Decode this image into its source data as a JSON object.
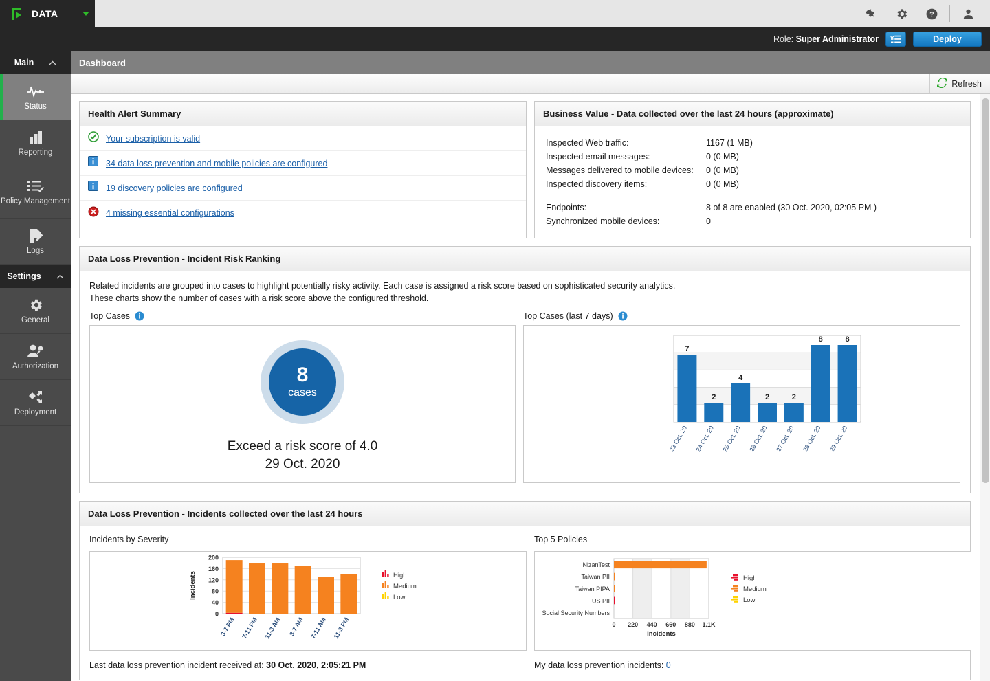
{
  "brand": {
    "name": "DATA",
    "logo_icon": "forcepoint-logo-icon",
    "caret_icon": "chevron-down-icon"
  },
  "topbar": {
    "icons": [
      {
        "name": "plugin-icon",
        "glyph": "plug"
      },
      {
        "name": "gear-icon",
        "glyph": "gear"
      },
      {
        "name": "help-icon",
        "glyph": "question"
      },
      {
        "name": "user-icon",
        "glyph": "user"
      }
    ]
  },
  "rolebar": {
    "role_prefix": "Role:",
    "role_value": "Super Administrator",
    "list_icon": "task-list-icon",
    "deploy_label": "Deploy",
    "accent": "#1377c0"
  },
  "sidebar": {
    "main_label": "Main",
    "main_caret_icon": "chevron-up-icon",
    "settings_label": "Settings",
    "settings_caret_icon": "chevron-up-icon",
    "items": [
      {
        "label": "Status",
        "icon": "pulse-icon",
        "active": true
      },
      {
        "label": "Reporting",
        "icon": "bar-chart-icon",
        "active": false
      },
      {
        "label": "Policy Management",
        "icon": "checklist-icon",
        "active": false
      },
      {
        "label": "Logs",
        "icon": "document-edit-icon",
        "active": false
      }
    ],
    "settings_items": [
      {
        "label": "General",
        "icon": "gear-icon"
      },
      {
        "label": "Authorization",
        "icon": "user-key-icon"
      },
      {
        "label": "Deployment",
        "icon": "deployment-icon"
      }
    ]
  },
  "page": {
    "title": "Dashboard"
  },
  "toolbar": {
    "refresh_label": "Refresh",
    "refresh_icon": "refresh-icon"
  },
  "health": {
    "title": "Health Alert Summary",
    "rows": [
      {
        "icon": "success-check-icon",
        "text": "Your subscription is valid"
      },
      {
        "icon": "info-icon",
        "text": "34 data loss prevention and mobile policies are configured"
      },
      {
        "icon": "info-icon",
        "text": "19 discovery policies are configured"
      },
      {
        "icon": "error-icon",
        "text": "4 missing essential configurations"
      }
    ]
  },
  "business": {
    "title": "Business Value - Data collected over the last 24 hours (approximate)",
    "rows": [
      {
        "key": "Inspected Web traffic:",
        "value": "1167 (1 MB)"
      },
      {
        "key": "Inspected email messages:",
        "value": "0 (0 MB)"
      },
      {
        "key": "Messages delivered to mobile devices:",
        "value": "0 (0 MB)"
      },
      {
        "key": "Inspected discovery items:",
        "value": "0 (0 MB)"
      }
    ],
    "rows2": [
      {
        "key": "Endpoints:",
        "value": "8 of 8 are enabled (30 Oct. 2020, 02:05 PM )"
      },
      {
        "key": "Synchronized mobile devices:",
        "value": "0"
      }
    ]
  },
  "risk": {
    "title": "Data Loss Prevention - Incident Risk Ranking",
    "desc_line1": "Related incidents are grouped into cases to highlight potentially risky activity. Each case is assigned a risk score based on sophisticated security analytics.",
    "desc_line2": "These charts show the number of cases with a risk score above the configured threshold.",
    "left_caption": "Top Cases",
    "right_caption": "Top Cases (last 7 days)",
    "info_icon": "info-circle-icon",
    "donut": {
      "count": "8",
      "unit": "cases",
      "caption_line1": "Exceed a risk score of 4.0",
      "caption_line2": "29 Oct. 2020",
      "ring_color": "#ccdcea",
      "fill_color": "#1664a7"
    }
  },
  "incidents": {
    "title": "Data Loss Prevention - Incidents collected over the last 24 hours",
    "left_caption": "Incidents by Severity",
    "right_caption": "Top 5 Policies",
    "foot_left_label": "Last data loss prevention incident received at:",
    "foot_left_value": "30 Oct. 2020, 2:05:21 PM",
    "foot_right_label": "My data loss prevention incidents:",
    "foot_right_value": "0"
  },
  "chart_data": [
    {
      "type": "bar",
      "title": "Top Cases (last 7 days)",
      "categories": [
        "23 Oct. 20",
        "24 Oct. 20",
        "25 Oct. 20",
        "26 Oct. 20",
        "27 Oct. 20",
        "28 Oct. 20",
        "29 Oct. 20"
      ],
      "values": [
        7,
        2,
        4,
        2,
        2,
        8,
        8
      ],
      "xlabel": "",
      "ylabel": "",
      "ylim": [
        0,
        9
      ],
      "grid": true,
      "legend": "none",
      "bar_color": "#1a72b8",
      "data_labels": true
    },
    {
      "type": "bar",
      "title": "Incidents by Severity",
      "categories": [
        "3-7 PM",
        "7-11 PM",
        "11-3 AM",
        "3-7 AM",
        "7-11 AM",
        "11-3 PM"
      ],
      "series": [
        {
          "name": "High",
          "values": [
            3,
            0,
            0,
            0,
            0,
            0
          ],
          "color": "#e8112d"
        },
        {
          "name": "Medium",
          "values": [
            187,
            178,
            178,
            169,
            130,
            140
          ],
          "color": "#f5821f"
        },
        {
          "name": "Low",
          "values": [
            0,
            0,
            0,
            0,
            0,
            0
          ],
          "color": "#ffd300"
        }
      ],
      "xlabel": "",
      "ylabel": "Incidents",
      "yticks": [
        0,
        40,
        80,
        120,
        160,
        200
      ],
      "ylim": [
        0,
        200
      ],
      "grid": true,
      "legend": "right",
      "legend_entries": [
        "High",
        "Medium",
        "Low"
      ]
    },
    {
      "type": "bar",
      "orientation": "horizontal",
      "title": "Top 5 Policies",
      "categories": [
        "NizanTest",
        "Taiwan PII",
        "Taiwan PIPA",
        "US PII",
        "Social Security Numbers"
      ],
      "series": [
        {
          "name": "High",
          "values": [
            0,
            0,
            0,
            8,
            0
          ],
          "color": "#e8112d"
        },
        {
          "name": "Medium",
          "values": [
            1075,
            10,
            10,
            0,
            0
          ],
          "color": "#f5821f"
        },
        {
          "name": "Low",
          "values": [
            0,
            0,
            0,
            0,
            0
          ],
          "color": "#ffd300"
        }
      ],
      "xlabel": "Incidents",
      "ylabel": "",
      "xticks": [
        "0",
        "220",
        "440",
        "660",
        "880",
        "1.1K"
      ],
      "xlim": [
        0,
        1100
      ],
      "grid": true,
      "legend": "right",
      "legend_entries": [
        "High",
        "Medium",
        "Low"
      ]
    }
  ]
}
